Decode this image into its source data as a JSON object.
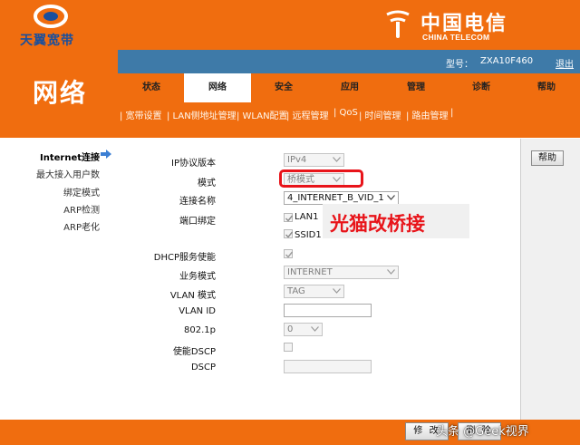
{
  "colors": {
    "brand_orange": "#f06d0f",
    "header_blue": "#3e7aa8",
    "brand_blue": "#1a4f9c",
    "annotation_red": "#e8141a"
  },
  "header": {
    "brand_text": "天翼宽带",
    "carrier_cn": "中国电信",
    "carrier_en": "CHINA TELECOM",
    "model_label": "型号：",
    "model_value": "ZXA10F460",
    "logout_label": "退出"
  },
  "section_title": "网络",
  "tabs": [
    {
      "label": "状态",
      "active": false
    },
    {
      "label": "网络",
      "active": true
    },
    {
      "label": "安全",
      "active": false
    },
    {
      "label": "应用",
      "active": false
    },
    {
      "label": "管理",
      "active": false
    },
    {
      "label": "诊断",
      "active": false
    },
    {
      "label": "帮助",
      "active": false
    }
  ],
  "submenu": [
    "| 宽带设置",
    "| LAN侧地址管理",
    "| WLAN配置",
    "| 远程管理",
    "| QoS",
    "| 时间管理",
    "| 路由管理",
    "|"
  ],
  "left_nav": {
    "items": [
      "Internet连接",
      "最大接入用户数",
      "绑定模式",
      "ARP检测",
      "ARP老化"
    ],
    "current_icon": "right-arrow-icon"
  },
  "form": {
    "ip_version": {
      "label": "IP协议版本",
      "value": "IPv4"
    },
    "mode": {
      "label": "模式",
      "value": "桥模式"
    },
    "connection_name": {
      "label": "连接名称",
      "value": "4_INTERNET_B_VID_1"
    },
    "port_binding": {
      "label": "端口绑定",
      "options": [
        "LAN1",
        "SSID1"
      ]
    },
    "dhcp_service": {
      "label": "DHCP服务使能"
    },
    "service_mode": {
      "label": "业务模式",
      "value": "INTERNET"
    },
    "vlan_mode": {
      "label": "VLAN 模式",
      "value": "TAG"
    },
    "vlan_id": {
      "label": "VLAN ID",
      "value": ""
    },
    "dot1p": {
      "label": "802.1p",
      "value": "0"
    },
    "enable_dscp": {
      "label": "使能DSCP"
    },
    "dscp": {
      "label": "DSCP",
      "value": ""
    }
  },
  "help_button": "帮助",
  "annotation": "光猫改桥接",
  "bottom": {
    "modify_label": "修 改",
    "delete_label": "删 除"
  },
  "watermark": "头条 @Geek视界"
}
